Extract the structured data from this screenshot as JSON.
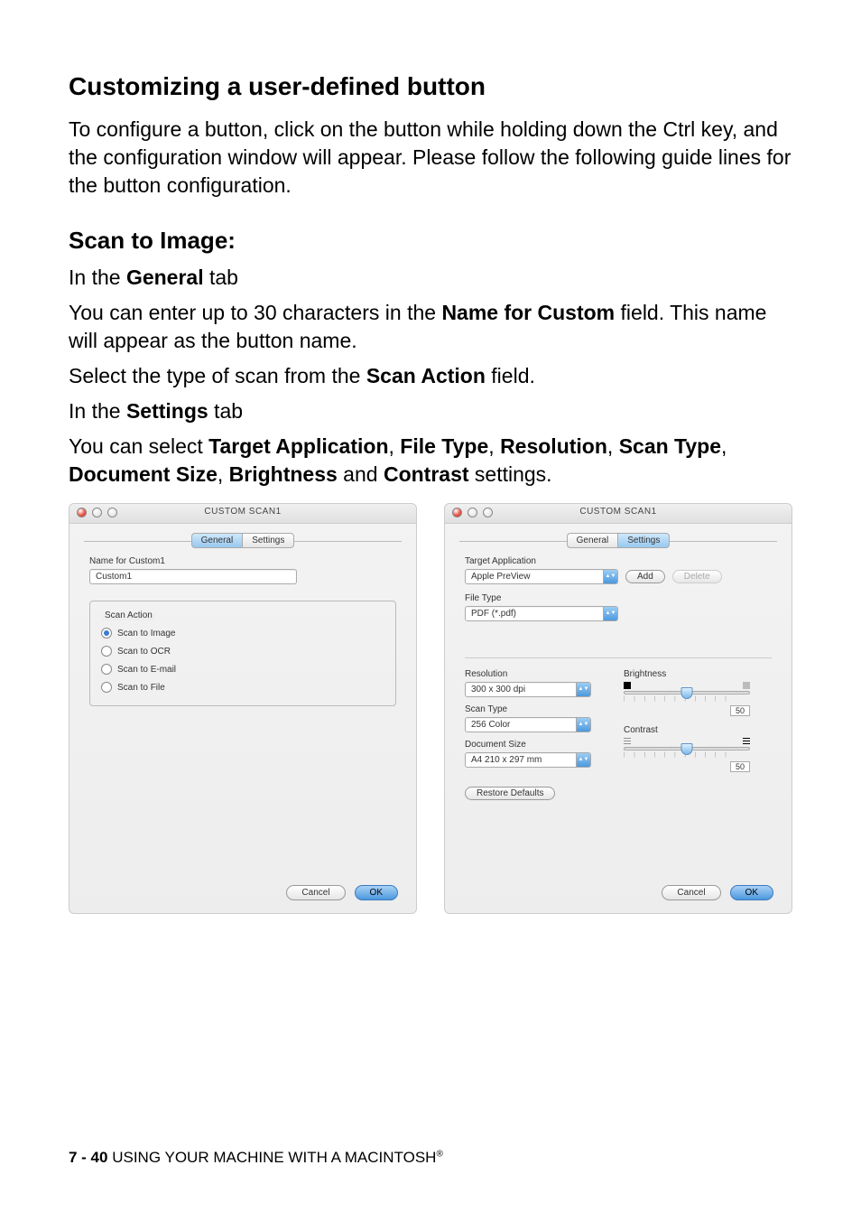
{
  "headings": {
    "h2": "Customizing a user-defined button",
    "h3_scan_to_image": "Scan to Image:"
  },
  "paragraphs": {
    "p1": "To configure a button, click on the button while holding down the Ctrl key, and the configuration window will appear. Please follow the following guide lines for the button configuration.",
    "gen_tab_line_pre": "In the ",
    "gen_tab_bold": "General",
    "gen_tab_post": " tab",
    "name_for_custom_pre": "You can enter up to 30 characters in the ",
    "name_for_custom_bold": "Name for Custom",
    "name_for_custom_post": " field. This name will appear as the button name.",
    "scan_action_pre": "Select the type of scan from the ",
    "scan_action_bold": "Scan Action",
    "scan_action_post": " field.",
    "set_tab_line_pre": "In the ",
    "set_tab_bold": "Settings",
    "set_tab_post": " tab",
    "select_line_pre": "You can select ",
    "b_target_app": "Target Application",
    "sep1": ", ",
    "b_file_type": "File Type",
    "sep2": ", ",
    "b_resolution": "Resolution",
    "sep3": ", ",
    "b_scan_type": "Scan Type",
    "sep4": ", ",
    "b_doc_size": "Document Size",
    "sep5": ", ",
    "b_brightness": "Brightness",
    "and": " and ",
    "b_contrast": "Contrast",
    "select_line_post": " settings."
  },
  "window": {
    "title": "CUSTOM SCAN1",
    "tabs": {
      "general": "General",
      "settings": "Settings"
    }
  },
  "general": {
    "name_label": "Name for Custom1",
    "name_value": "Custom1",
    "scan_action_group": "Scan Action",
    "opts": {
      "image": "Scan to Image",
      "ocr": "Scan to OCR",
      "email": "Scan to E-mail",
      "file": "Scan to File"
    }
  },
  "settings": {
    "target_app_label": "Target Application",
    "target_app_value": "Apple PreView",
    "add_btn": "Add",
    "delete_btn": "Delete",
    "file_type_label": "File Type",
    "file_type_value": "PDF (*.pdf)",
    "resolution_label": "Resolution",
    "resolution_value": "300 x 300 dpi",
    "scan_type_label": "Scan Type",
    "scan_type_value": "256 Color",
    "doc_size_label": "Document Size",
    "doc_size_value": "A4 210 x 297 mm",
    "brightness_label": "Brightness",
    "brightness_value": "50",
    "contrast_label": "Contrast",
    "contrast_value": "50",
    "restore": "Restore Defaults"
  },
  "buttons": {
    "cancel": "Cancel",
    "ok": "OK"
  },
  "footer": {
    "page": "7 - 40",
    "sep": "   ",
    "text": "USING YOUR MACHINE WITH A MACINTOSH",
    "reg": "®"
  }
}
